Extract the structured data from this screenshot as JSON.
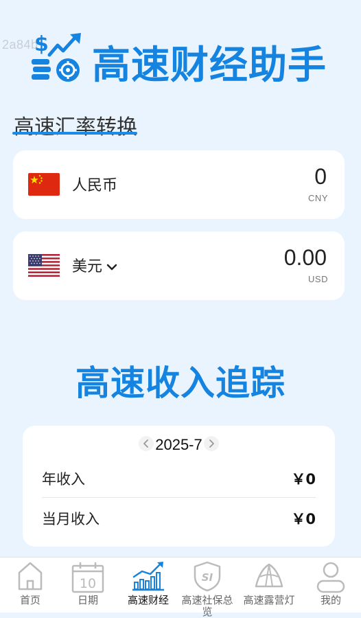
{
  "watermark": "2a84b",
  "app": {
    "title": "高速财经助手"
  },
  "converter": {
    "section_title": "高速汇率转换",
    "from": {
      "name": "人民币",
      "amount": "0",
      "code": "CNY"
    },
    "to": {
      "name": "美元",
      "amount": "0.00",
      "code": "USD"
    }
  },
  "income": {
    "heading": "高速收入追踪",
    "month": "2025-7",
    "rows": [
      {
        "label": "年收入",
        "value": "￥0"
      },
      {
        "label": "当月收入",
        "value": "￥0"
      }
    ]
  },
  "tabbar": {
    "tabs": [
      {
        "label": "首页"
      },
      {
        "label": "日期",
        "icon_text": "10"
      },
      {
        "label": "高速财经"
      },
      {
        "label": "高速社保总览",
        "icon_text": "SI"
      },
      {
        "label": "高速露营灯"
      },
      {
        "label": "我的"
      }
    ],
    "active_index": 2
  },
  "colors": {
    "accent": "#1584e0",
    "background": "#eaf4fe",
    "card": "#ffffff"
  }
}
